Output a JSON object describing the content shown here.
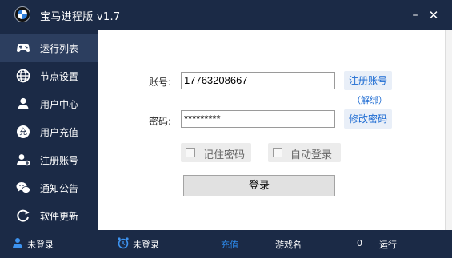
{
  "window": {
    "title": "宝马进程版 v1.7",
    "minimize_glyph": "–",
    "close_glyph": "✕"
  },
  "sidebar": {
    "items": [
      {
        "label": "运行列表",
        "icon": "gamepad-icon",
        "active": true
      },
      {
        "label": "节点设置",
        "icon": "globe-icon",
        "active": false
      },
      {
        "label": "用户中心",
        "icon": "user-icon",
        "active": false
      },
      {
        "label": "用户充值",
        "icon": "recharge-icon",
        "active": false
      },
      {
        "label": "注册账号",
        "icon": "add-user-icon",
        "active": false
      },
      {
        "label": "通知公告",
        "icon": "chat-icon",
        "active": false
      },
      {
        "label": "软件更新",
        "icon": "refresh-icon",
        "active": false
      }
    ]
  },
  "login": {
    "account_label": "账号:",
    "account_value": "17763208667",
    "password_label": "密码:",
    "password_value": "*********",
    "register_label": "注册账号",
    "unbind_label": "（解绑）",
    "change_password_label": "修改密码",
    "remember_label": "记住密码",
    "auto_login_label": "自动登录",
    "login_button": "登录"
  },
  "statusbar": {
    "user_status": "未登录",
    "alarm_status": "未登录",
    "recharge": "充值",
    "game_name_label": "游戏名",
    "count": "0",
    "running_label": "运行"
  },
  "colors": {
    "nav_bg": "#1b2a46",
    "active_item": "#2c3e5f",
    "link": "#1b6ad2",
    "status_link": "#2e8df0"
  }
}
